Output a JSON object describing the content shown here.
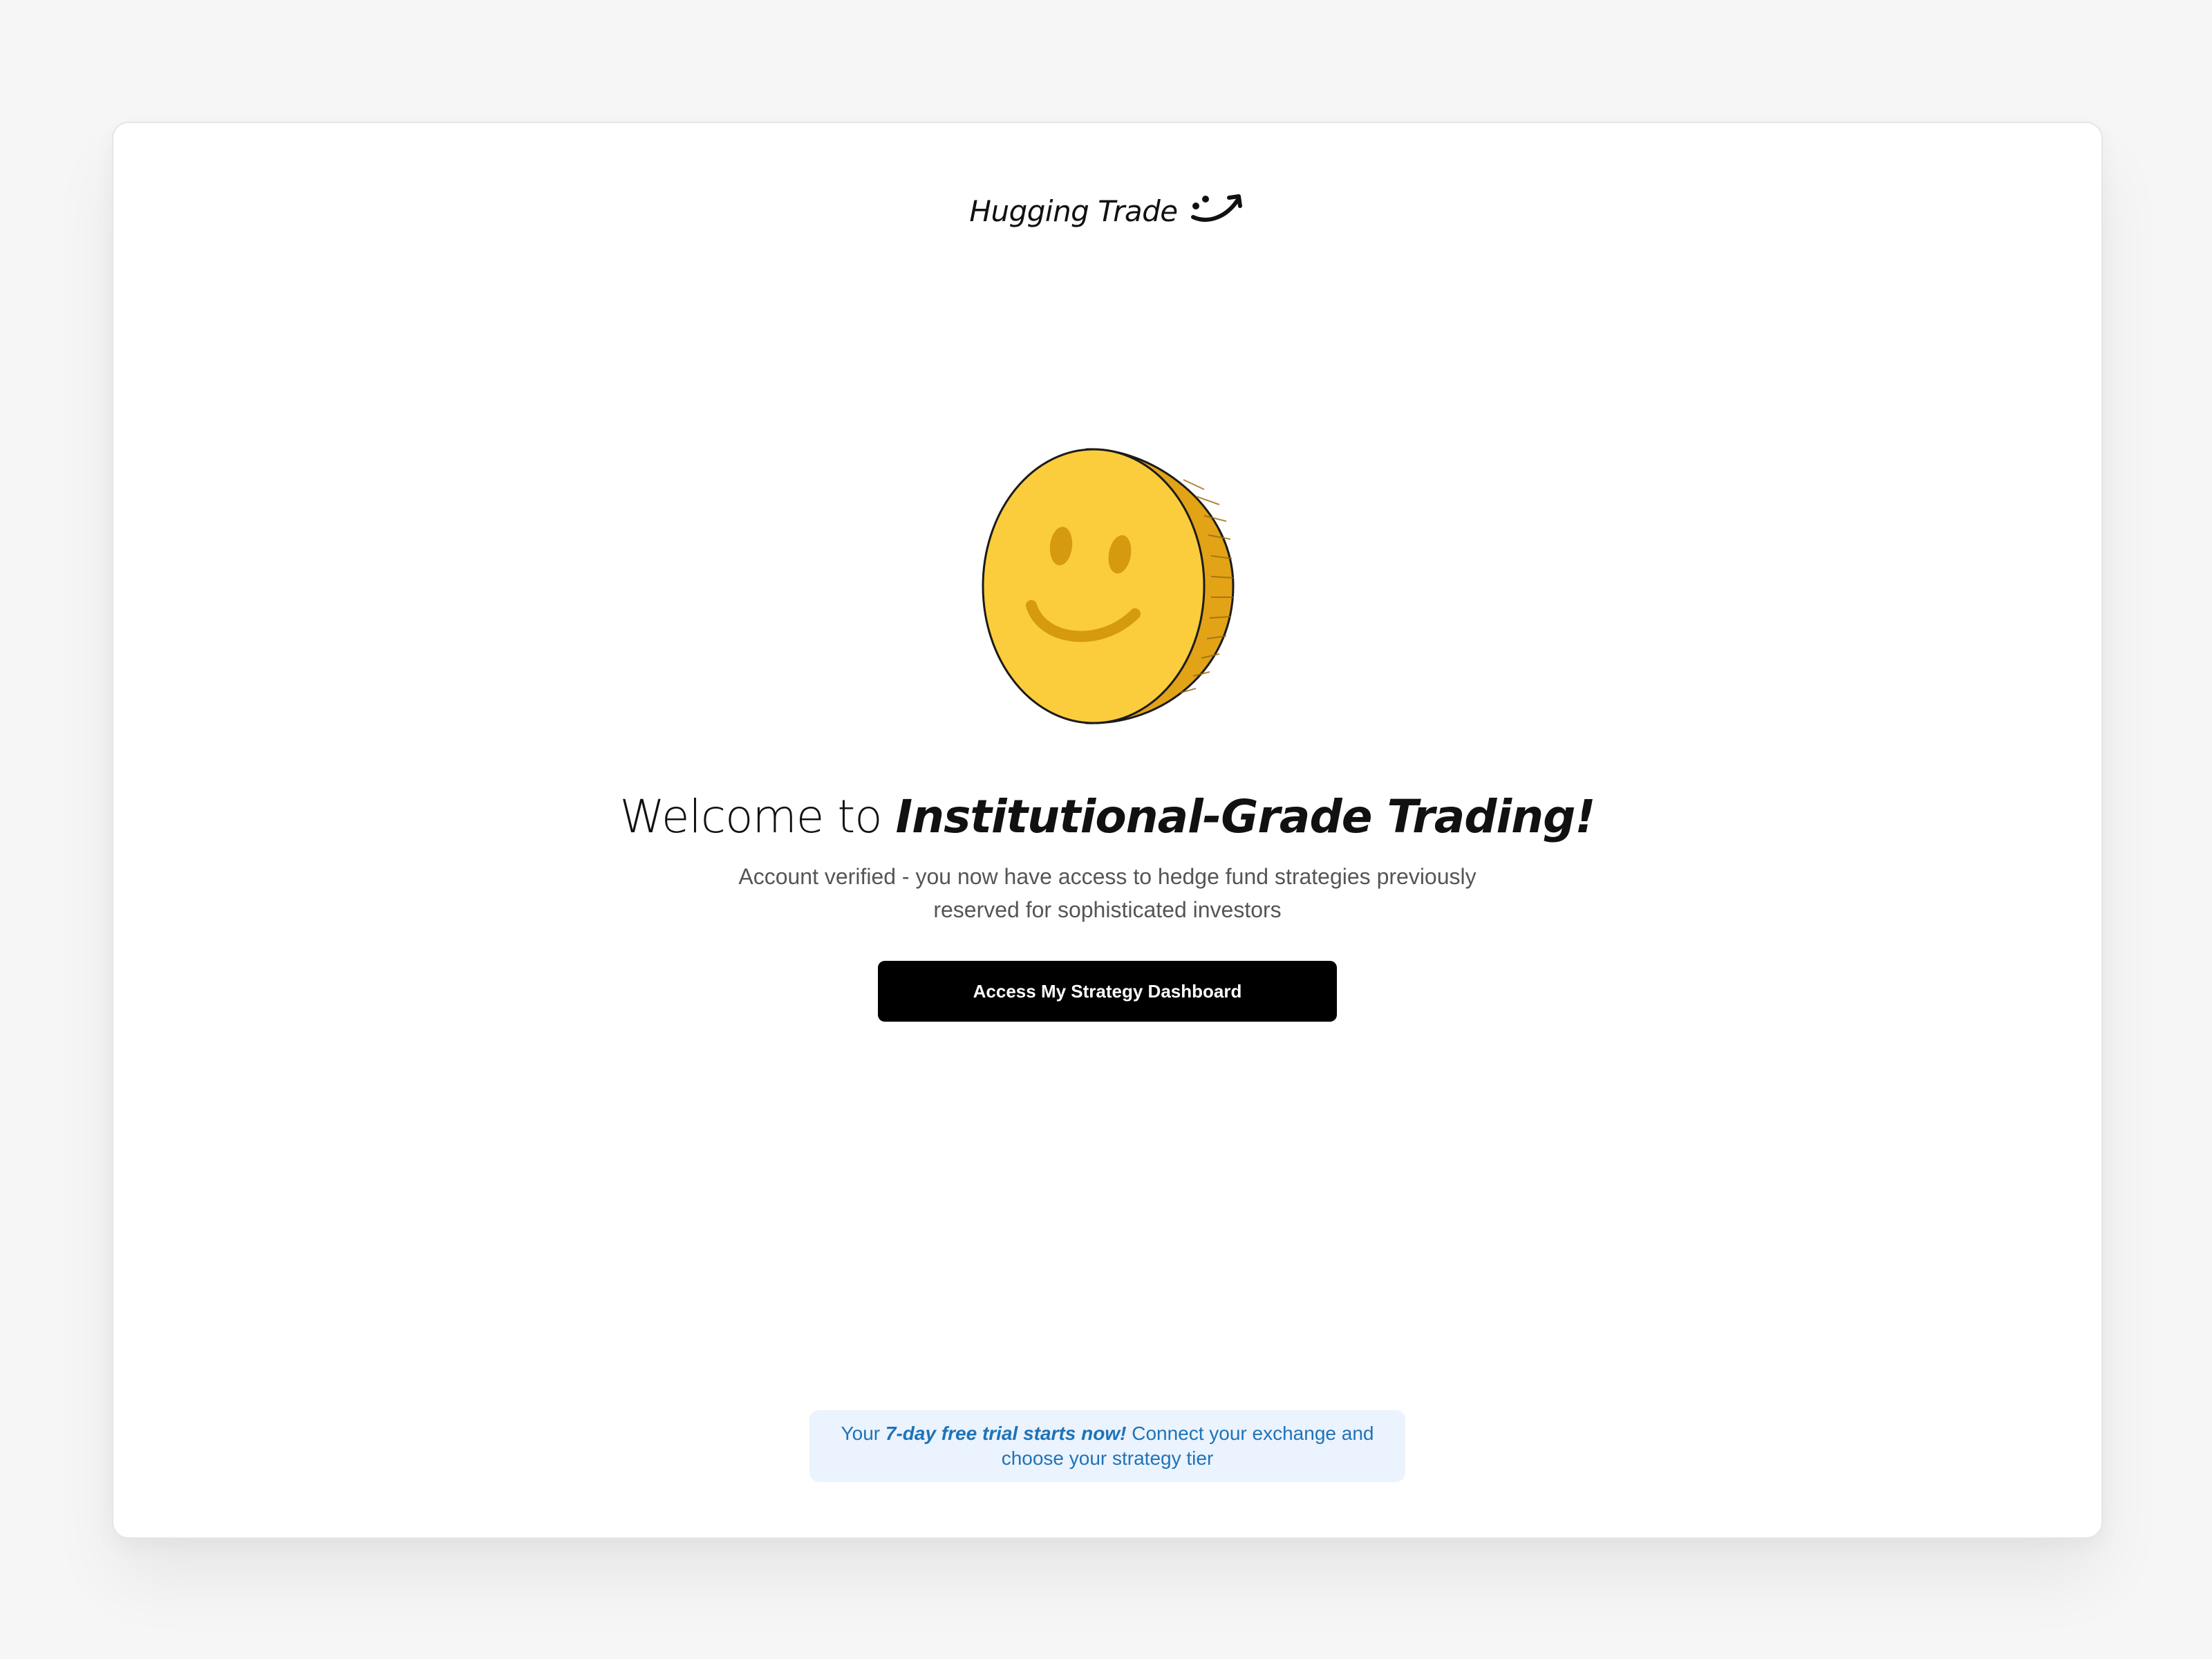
{
  "brand": {
    "name": "Hugging Trade",
    "logo_icon": "smile-arrow-icon"
  },
  "hero": {
    "illustration_icon": "smiley-coin-icon",
    "headline_plain": "Welcome to ",
    "headline_emphasis": "Institutional-Grade Trading!",
    "subtext_line1": "Account verified - you now have access to hedge fund strategies previously",
    "subtext_line2": "reserved for sophisticated investors",
    "cta_label": "Access My Strategy Dashboard"
  },
  "trial_notice": {
    "prefix": "Your ",
    "emphasis": "7-day free trial starts now!",
    "suffix": " Connect your exchange and",
    "line2": "choose your strategy tier"
  },
  "colors": {
    "page_bg": "#f6f6f6",
    "card_bg": "#ffffff",
    "coin_face": "#fbcd3c",
    "coin_edge": "#e2a317",
    "coin_features": "#d69a10",
    "cta_bg": "#000000",
    "trial_bg": "#ebf3fe",
    "trial_text": "#1f73b7"
  }
}
